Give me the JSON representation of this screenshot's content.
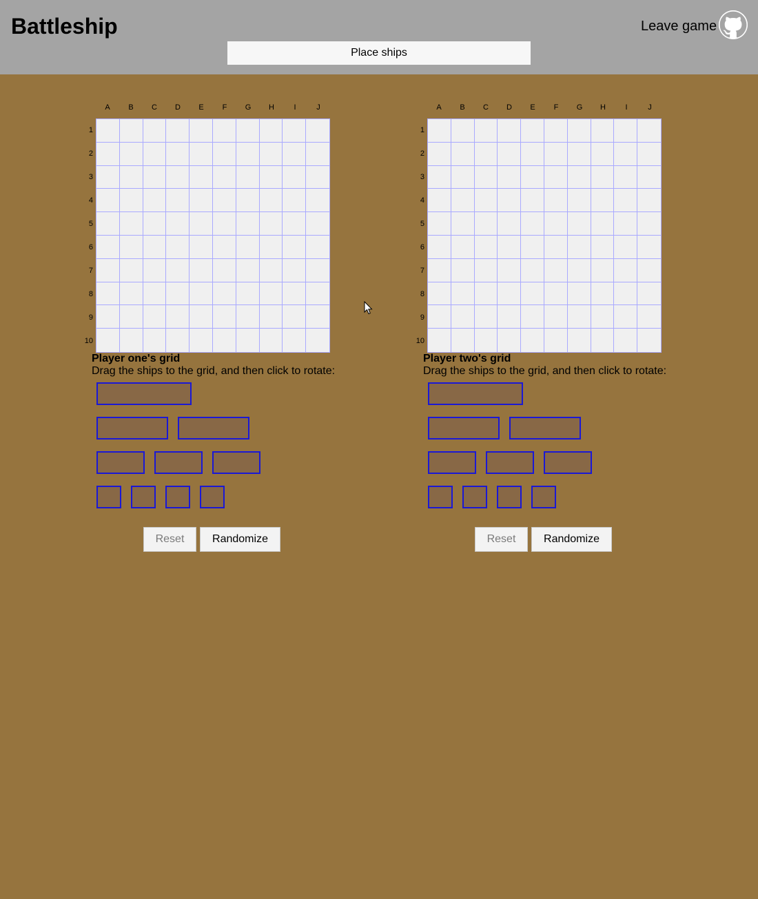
{
  "header": {
    "title": "Battleship",
    "leave_label": "Leave game",
    "github_icon": "github-icon",
    "status": "Place ships"
  },
  "columns": [
    "A",
    "B",
    "C",
    "D",
    "E",
    "F",
    "G",
    "H",
    "I",
    "J"
  ],
  "rows": [
    "1",
    "2",
    "3",
    "4",
    "5",
    "6",
    "7",
    "8",
    "9",
    "10"
  ],
  "boards": [
    {
      "title": "Player one's grid",
      "instructions": "Drag the ships to the grid, and then click to rotate:",
      "ships": [
        4,
        3,
        3,
        2,
        2,
        2,
        1,
        1,
        1,
        1
      ],
      "reset_label": "Reset",
      "reset_disabled": true,
      "randomize_label": "Randomize"
    },
    {
      "title": "Player two's grid",
      "instructions": "Drag the ships to the grid, and then click to rotate:",
      "ships": [
        4,
        3,
        3,
        2,
        2,
        2,
        1,
        1,
        1,
        1
      ],
      "reset_label": "Reset",
      "reset_disabled": true,
      "randomize_label": "Randomize"
    }
  ],
  "colors": {
    "background": "#96743e",
    "header": "#a4a4a4",
    "grid_line": "#a9a9ff",
    "ship_fill": "#886846",
    "ship_border": "#1a18d6"
  }
}
